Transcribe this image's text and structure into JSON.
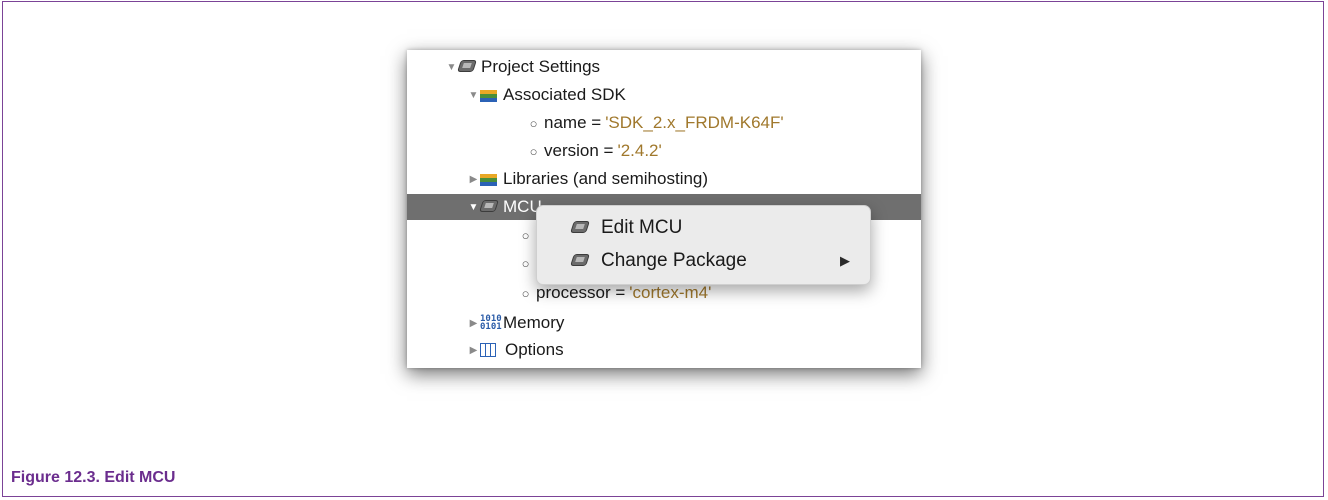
{
  "tree": {
    "project_settings": "Project Settings",
    "associated_sdk": "Associated SDK",
    "sdk_name_key": "name = ",
    "sdk_name_value": "'SDK_2.x_FRDM-K64F'",
    "sdk_version_key": "version = ",
    "sdk_version_value": "'2.4.2'",
    "libraries": "Libraries (and semihosting)",
    "mcu": "MCU",
    "processor_key": "processor = ",
    "processor_value": "'cortex-m4'",
    "memory": "Memory",
    "options": "Options"
  },
  "context_menu": {
    "edit_mcu": "Edit MCU",
    "change_package": "Change Package",
    "submenu_arrow": "▶"
  },
  "caption": "Figure 12.3. Edit MCU",
  "colors": {
    "caption": "#6b2d8e",
    "string_value": "#a0782c",
    "selected_row": "#6f6f6f",
    "frame_border": "#7b4397"
  },
  "icons": [
    "disclosure-triangle-icon",
    "chip-icon",
    "books-icon",
    "binary-icon",
    "table-icon",
    "bullet-icon"
  ]
}
